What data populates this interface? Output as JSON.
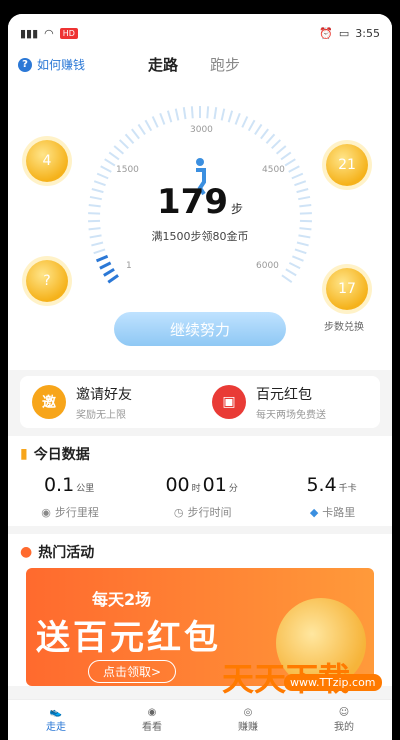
{
  "status_bar": {
    "left": "all",
    "time": "3:55",
    "badge": "HD"
  },
  "top": {
    "help_label": "如何赚钱",
    "help_icon": "?"
  },
  "tabs": [
    {
      "label": "走路",
      "active": true
    },
    {
      "label": "跑步",
      "active": false
    }
  ],
  "gauge": {
    "ticks": [
      "1",
      "1500",
      "3000",
      "4500",
      "6000"
    ],
    "steps": "179",
    "unit": "步",
    "reward": "满1500步领80金币"
  },
  "coins": [
    {
      "value": "4"
    },
    {
      "value": "21"
    },
    {
      "value": "?"
    },
    {
      "value": "17"
    }
  ],
  "coin_exchange_label": "步数兑换",
  "cta_label": "继续努力",
  "cards": [
    {
      "title": "邀请好友",
      "subtitle": "奖励无上限",
      "icon_text": "邀",
      "color": "#f7a51a"
    },
    {
      "title": "百元红包",
      "subtitle": "每天两场免费送",
      "icon_text": "",
      "color": "#e93b36"
    }
  ],
  "today": {
    "title": "今日数据",
    "stats": [
      {
        "value": "0.1",
        "unit": "公里",
        "label": "步行里程"
      },
      {
        "value": "00",
        "unit": "时",
        "value2": "01",
        "unit2": "分",
        "label": "步行时间"
      },
      {
        "value": "5.4",
        "unit": "千卡",
        "label": "卡路里"
      }
    ]
  },
  "hot": {
    "title": "热门活动",
    "banner_sub": "每天2场",
    "banner_main": "送百元红包",
    "banner_button": "点击领取>"
  },
  "watermark": {
    "text": "天天下载",
    "url": "www.TTzip.com"
  },
  "nav": [
    {
      "label": "走走",
      "active": true
    },
    {
      "label": "看看",
      "active": false
    },
    {
      "label": "赚赚",
      "active": false
    },
    {
      "label": "我的",
      "active": false
    }
  ],
  "colors": {
    "accent": "#2b78d6",
    "coin": "#f5b21b",
    "banner": "#ff6a2e"
  }
}
